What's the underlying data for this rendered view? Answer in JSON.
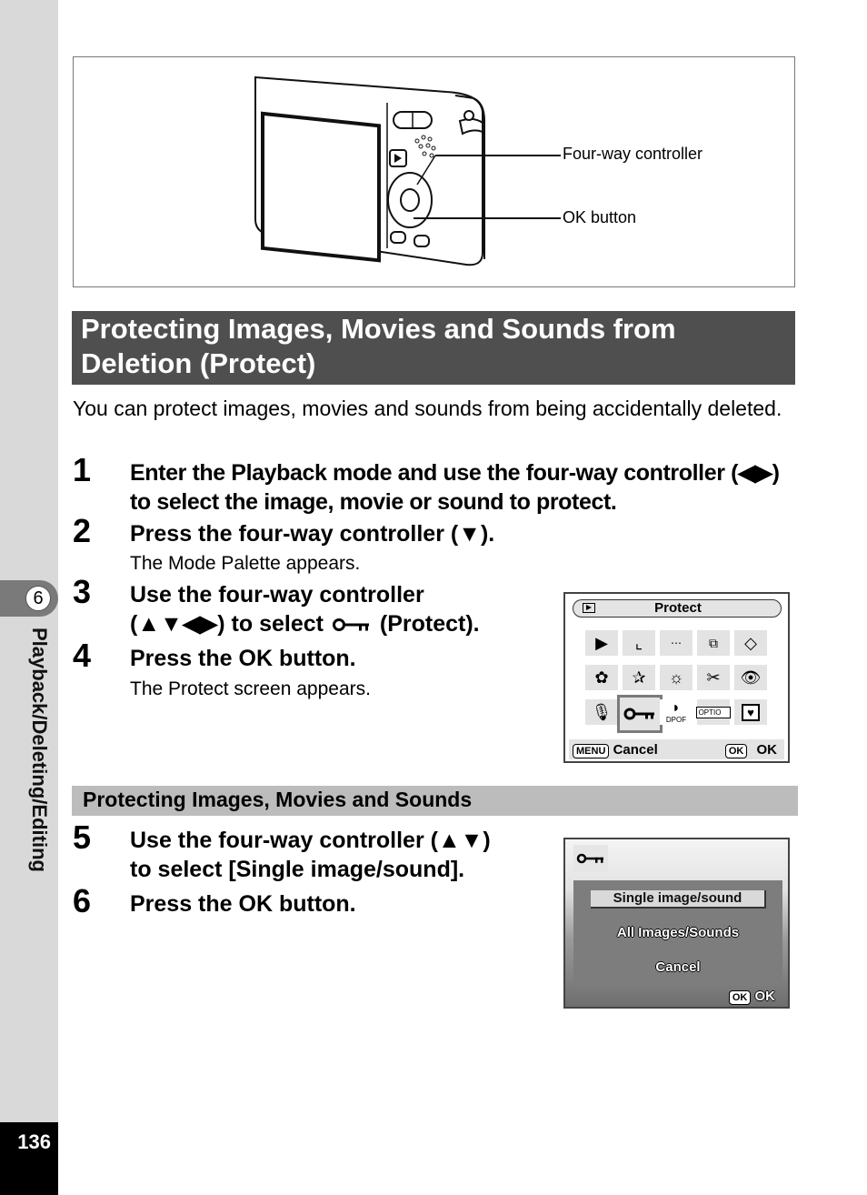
{
  "sidebar": {
    "chapter_number": "6",
    "chapter_title": "Playback/Deleting/Editing",
    "page_number": "136"
  },
  "figure": {
    "callouts": [
      "Four-way controller",
      "OK button"
    ]
  },
  "section": {
    "title": "Protecting Images, Movies and Sounds from Deletion (Protect)",
    "intro": "You can protect images, movies and sounds from being accidentally deleted."
  },
  "steps": [
    {
      "num": "1",
      "text": "Enter the Playback mode and use the four-way controller (◀▶) to select the image, movie or sound to protect.",
      "sub": ""
    },
    {
      "num": "2",
      "text": "Press the four-way controller (▼).",
      "sub": "The Mode Palette appears."
    },
    {
      "num": "3",
      "text_a": "Use the four-way controller",
      "text_b": "(▲▼◀▶) to select",
      "text_c": "(Protect).",
      "sub": ""
    },
    {
      "num": "4",
      "text": "Press the OK button.",
      "sub": "The Protect screen appears."
    },
    {
      "num": "5",
      "text_a": "Use the four-way controller (▲▼)",
      "text_b": "to select [Single image/sound].",
      "sub": ""
    },
    {
      "num": "6",
      "text": "Press the OK button.",
      "sub": ""
    }
  ],
  "subsection": {
    "title": "Protecting Images, Movies and Sounds"
  },
  "mode_palette": {
    "title": "Protect",
    "icons": [
      [
        "playback-icon",
        "resize-icon",
        "cropping-icon",
        "image-copy-icon",
        "rotate-icon"
      ],
      [
        "frame-composite-icon",
        "digital-filter-icon",
        "brightness-filter-icon",
        "movie-edit-icon",
        "red-eye-icon"
      ],
      [
        "voice-memo-icon",
        "protect-key-icon",
        "dpof-icon",
        "start-up-screen-icon",
        "favorite-heart-icon"
      ]
    ],
    "selected": "protect-key-icon",
    "dpof_label": "DPOF",
    "menu_key": "MENU",
    "cancel_label": "Cancel",
    "ok_key": "OK",
    "ok_label": "OK"
  },
  "protect_screen": {
    "options": [
      "Single image/sound",
      "All Images/Sounds",
      "Cancel"
    ],
    "selected_index": 0,
    "ok_key": "OK",
    "ok_label": "OK"
  }
}
